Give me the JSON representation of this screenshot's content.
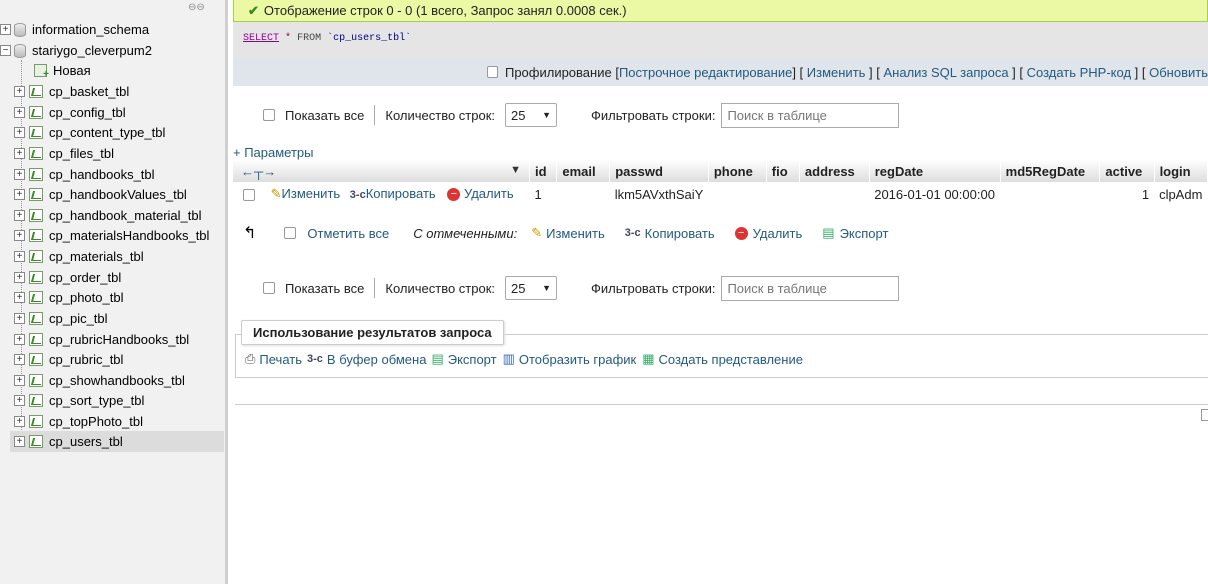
{
  "sidebar": {
    "items": [
      {
        "label": "information_schema",
        "type": "db"
      },
      {
        "label": "stariygo_cleverpum2",
        "type": "db"
      },
      {
        "label": "Новая",
        "type": "new"
      },
      {
        "label": "cp_basket_tbl",
        "type": "table"
      },
      {
        "label": "cp_config_tbl",
        "type": "table"
      },
      {
        "label": "cp_content_type_tbl",
        "type": "table"
      },
      {
        "label": "cp_files_tbl",
        "type": "table"
      },
      {
        "label": "cp_handbooks_tbl",
        "type": "table"
      },
      {
        "label": "cp_handbookValues_tbl",
        "type": "table"
      },
      {
        "label": "cp_handbook_material_tbl",
        "type": "table"
      },
      {
        "label": "cp_materialsHandbooks_tbl",
        "type": "table"
      },
      {
        "label": "cp_materials_tbl",
        "type": "table"
      },
      {
        "label": "cp_order_tbl",
        "type": "table"
      },
      {
        "label": "cp_photo_tbl",
        "type": "table"
      },
      {
        "label": "cp_pic_tbl",
        "type": "table"
      },
      {
        "label": "cp_rubricHandbooks_tbl",
        "type": "table"
      },
      {
        "label": "cp_rubric_tbl",
        "type": "table"
      },
      {
        "label": "cp_showhandbooks_tbl",
        "type": "table"
      },
      {
        "label": "cp_sort_type_tbl",
        "type": "table"
      },
      {
        "label": "cp_topPhoto_tbl",
        "type": "table"
      },
      {
        "label": "cp_users_tbl",
        "type": "table",
        "selected": true
      }
    ]
  },
  "status": {
    "message": "Отображение строк 0 - 0 (1 всего, Запрос занял 0.0008 сек.)"
  },
  "sql": {
    "select": "SELECT",
    "star": "*",
    "from": "FROM",
    "table": "`cp_users_tbl`"
  },
  "sql_links": {
    "profiling": "Профилирование",
    "inline_edit": "Построчное редактирование",
    "edit": "Изменить",
    "analyze": "Анализ SQL запроса",
    "php_code": "Создать PHP-код",
    "refresh": "Обновить"
  },
  "nav": {
    "show_all": "Показать все",
    "row_count_label": "Количество строк:",
    "row_count_value": "25",
    "filter_label": "Фильтровать строки:",
    "filter_placeholder": "Поиск в таблице"
  },
  "params_label": "+ Параметры",
  "table": {
    "columns": [
      "id",
      "email",
      "passwd",
      "phone",
      "fio",
      "address",
      "regDate",
      "md5RegDate",
      "active",
      "login"
    ],
    "rows": [
      {
        "edit": "Изменить",
        "copy": "Копировать",
        "delete": "Удалить",
        "id": "1",
        "email": "",
        "passwd": "lkm5AVxthSaiY",
        "phone": "",
        "fio": "",
        "address": "",
        "regDate": "2016-01-01 00:00:00",
        "md5RegDate": "",
        "active": "1",
        "login": "clpAdm"
      }
    ]
  },
  "with_selected": {
    "check_all": "Отметить все",
    "label": "С отмеченными:",
    "edit": "Изменить",
    "copy": "Копировать",
    "delete": "Удалить",
    "export": "Экспорт"
  },
  "usage": {
    "title": "Использование результатов запроса",
    "print": "Печать",
    "clipboard": "В буфер обмена",
    "export": "Экспорт",
    "chart": "Отобразить график",
    "view": "Создать представление"
  },
  "colors": {
    "success_bg": "#ebf8a4",
    "link": "#235a81",
    "sidebar_bg": "#f1f1f1"
  }
}
